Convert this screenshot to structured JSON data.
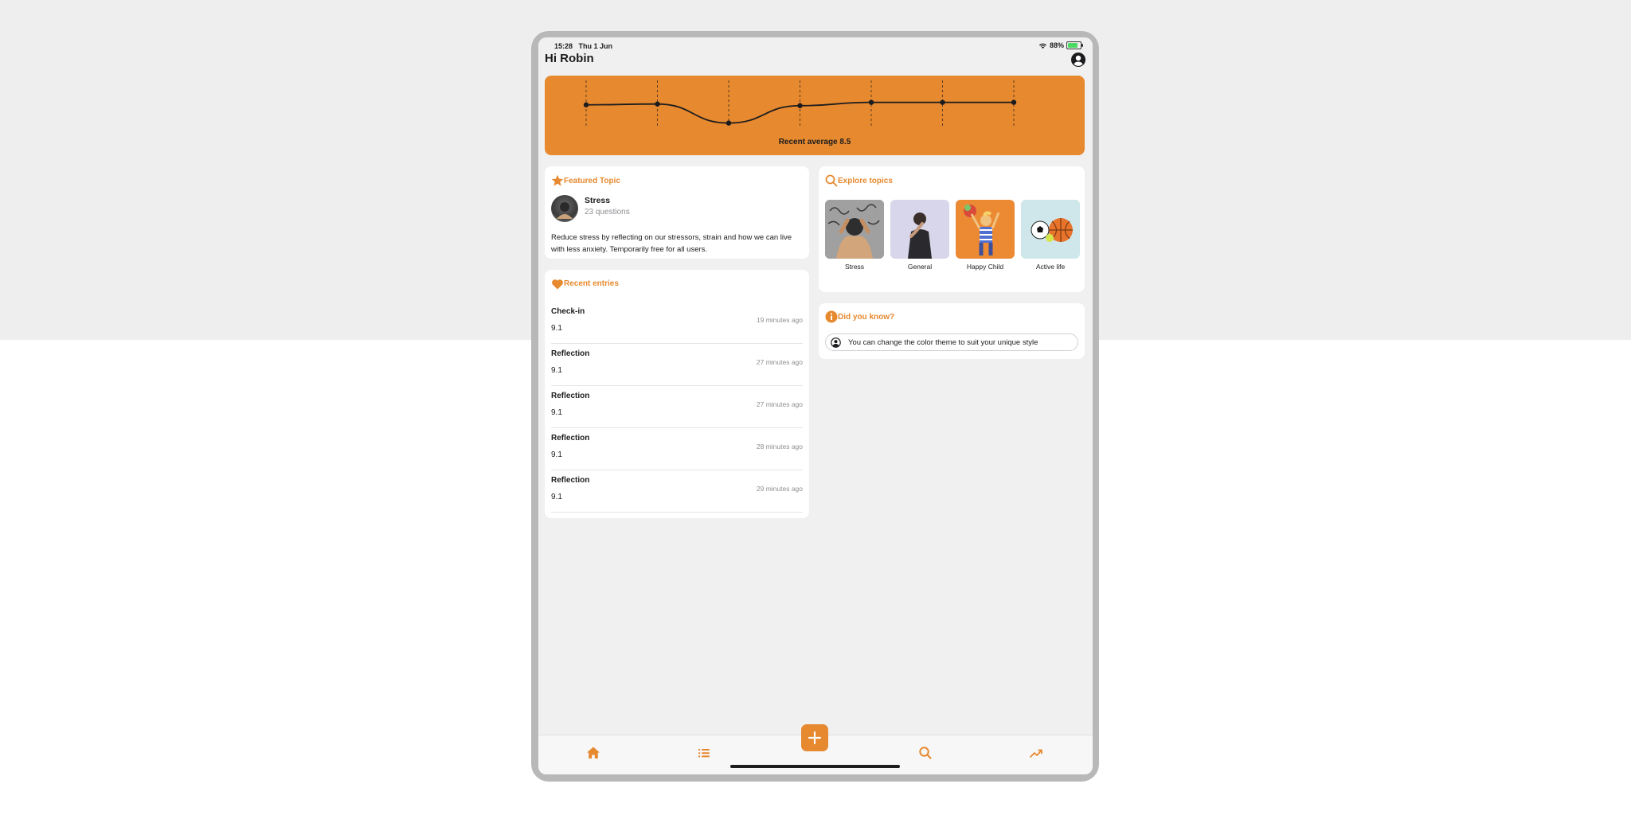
{
  "status": {
    "time": "15:28",
    "date": "Thu 1 Jun",
    "battery": "88%"
  },
  "header": {
    "greeting": "Hi Robin"
  },
  "chart_data": {
    "type": "line",
    "values": [
      8.2,
      8.3,
      6.0,
      8.1,
      8.5,
      8.5,
      8.5
    ],
    "ylim": [
      5,
      10
    ],
    "caption": "Recent average 8.5"
  },
  "featured": {
    "title": "Featured Topic",
    "topic_name": "Stress",
    "question_count": "23 questions",
    "description": "Reduce stress by reflecting on our stressors, strain and how we can live with less anxiety. Temporarily free for all users."
  },
  "explore": {
    "title": "Explore topics",
    "topics": [
      {
        "label": "Stress"
      },
      {
        "label": "General"
      },
      {
        "label": "Happy Child"
      },
      {
        "label": "Active life"
      }
    ]
  },
  "did_you_know": {
    "title": "Did you know?",
    "tip": "You can change the color theme to suit your unique style"
  },
  "recent": {
    "title": "Recent entries",
    "entries": [
      {
        "title": "Check-in",
        "value": "9.1",
        "time": "19 minutes ago"
      },
      {
        "title": "Reflection",
        "value": "9.1",
        "time": "27 minutes ago"
      },
      {
        "title": "Reflection",
        "value": "9.1",
        "time": "27 minutes ago"
      },
      {
        "title": "Reflection",
        "value": "9.1",
        "time": "28 minutes ago"
      },
      {
        "title": "Reflection",
        "value": "9.1",
        "time": "29 minutes ago"
      }
    ]
  },
  "theme": {
    "accent": "#e6892f",
    "background": "#f0f0f0"
  },
  "tabbar": {
    "icons": [
      "home-icon",
      "list-icon",
      "plus-icon",
      "search-icon",
      "trend-icon"
    ]
  }
}
